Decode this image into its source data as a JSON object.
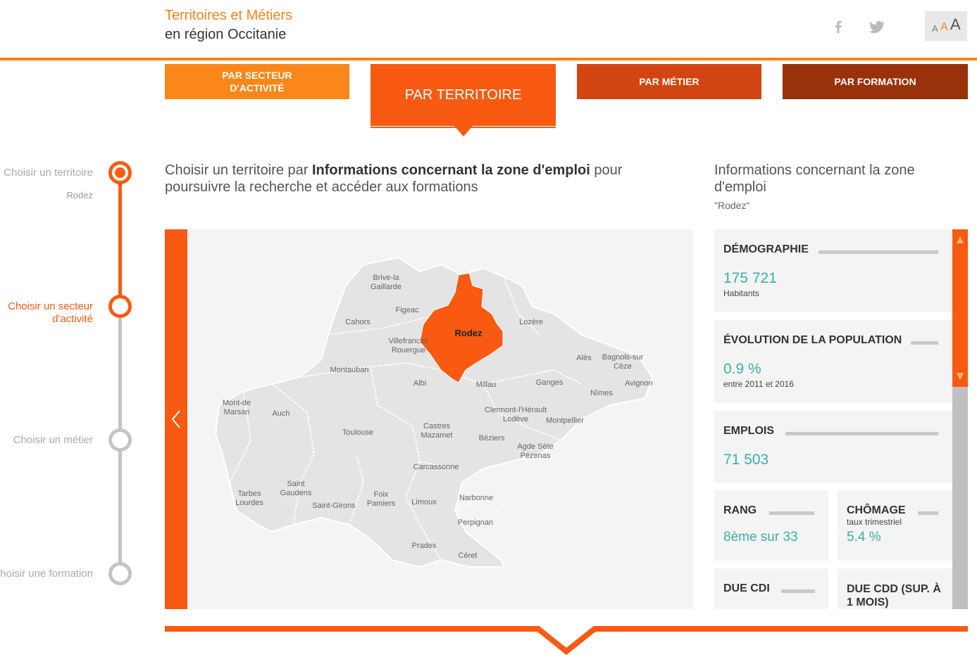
{
  "header": {
    "title": "Territoires et Métiers",
    "subtitle": "en région Occitanie",
    "social": [
      "facebook-icon",
      "twitter-icon"
    ],
    "font_size": {
      "small": "A",
      "medium": "A",
      "large": "A"
    }
  },
  "tabs": [
    {
      "label": "PAR SECTEUR D'ACTIVITÉ",
      "color": "#fb8619"
    },
    {
      "label": "PAR TERRITOIRE",
      "color": "#f85a12",
      "active": true
    },
    {
      "label": "PAR MÉTIER",
      "color": "#d24512"
    },
    {
      "label": "PAR FORMATION",
      "color": "#99310a"
    }
  ],
  "stepper": {
    "steps": [
      {
        "label": "Choisir un territoire",
        "value": "Rodez",
        "state": "done"
      },
      {
        "label": "Choisir un secteur d'activité",
        "state": "current"
      },
      {
        "label": "Choisir un métier",
        "state": "todo"
      },
      {
        "label": "Choisir une formation",
        "state": "todo"
      }
    ]
  },
  "intro": {
    "prefix": "Choisir un territoire par ",
    "bold": "Informations concernant la zone d'emploi",
    "suffix": " pour poursuivre la recherche et accéder aux formations"
  },
  "map": {
    "selected": "Rodez",
    "selected_color": "#f85a12",
    "zones": [
      "Brive-la Gaillarde",
      "Figeac",
      "Cahors",
      "Rodez",
      "Lozère",
      "Villefranche Rouergue",
      "Montauban",
      "Albi",
      "Millau",
      "Alès",
      "Bagnols-sur Cèze",
      "Ganges",
      "Avignon",
      "Nîmes",
      "Mont-de Marsan",
      "Auch",
      "Toulouse",
      "Clermont-l'Hérault Lodève",
      "Montpellier",
      "Castres Mazamet",
      "Béziers",
      "Agde Sète Pézenas",
      "Carcassonne",
      "Saint Gaudens",
      "Tarbes Lourdes",
      "Foix Pamiers",
      "Saint-Girons",
      "Limoux",
      "Narbonne",
      "Perpignan",
      "Prades",
      "Céret"
    ]
  },
  "info": {
    "title": "Informations concernant la zone d'emploi",
    "zone": "\"Rodez\"",
    "cards": {
      "demographie": {
        "title": "DÉMOGRAPHIE",
        "value": "175 721",
        "unit": "Habitants"
      },
      "evolution": {
        "title": "ÉVOLUTION DE LA POPULATION",
        "value": "0.9 %",
        "unit": "entre 2011 et 2016"
      },
      "emplois": {
        "title": "EMPLOIS",
        "value": "71 503"
      },
      "rang": {
        "title": "RANG",
        "value": "8ème sur 33"
      },
      "chomage": {
        "title": "CHÔMAGE",
        "note": "taux trimestriel",
        "value": "5.4 %"
      },
      "due_cdi": {
        "title": "DUE CDI"
      },
      "due_cdd": {
        "title": "DUE CDD (SUP. À 1 MOIS)"
      }
    }
  }
}
